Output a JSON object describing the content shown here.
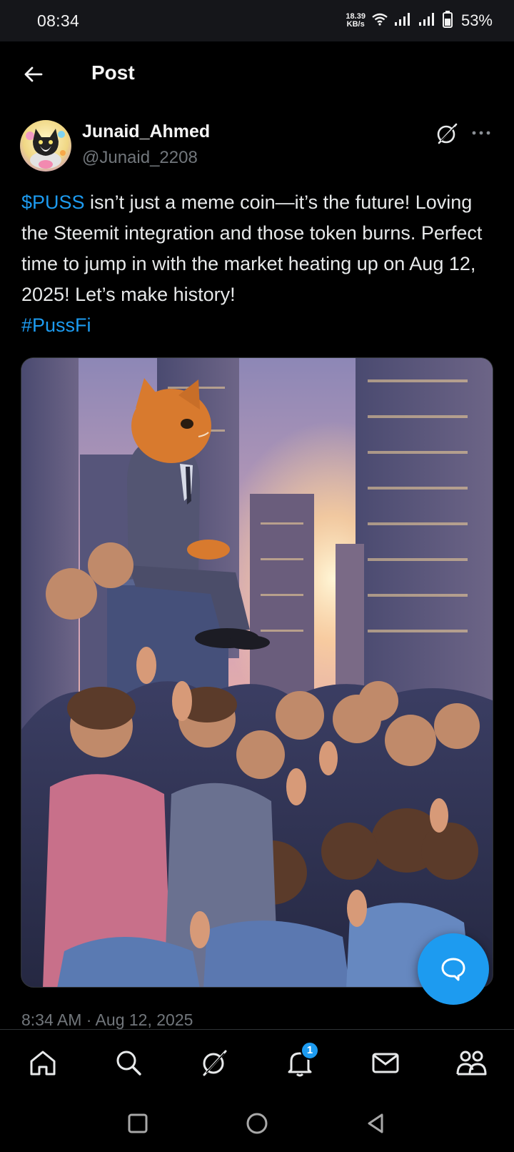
{
  "status": {
    "time": "08:34",
    "net_speed_value": "18.39",
    "net_speed_unit": "KB/s",
    "battery": "53%"
  },
  "header": {
    "title": "Post"
  },
  "author": {
    "name": "Junaid_Ahmed",
    "handle": "@Junaid_2208",
    "avatar_icon": "cat-avatar"
  },
  "post": {
    "cashtag": "$PUSS",
    "text": " isn’t just a meme coin—it’s the future! Loving the Steemit integration and those token burns. Perfect time to jump in with the market heating up on Aug 12, 2025! Let’s make history!",
    "hashtag": "#PussFi",
    "timestamp": "8:34 AM · Aug 12, 2025",
    "image_description_icon": "cat-in-suit-city-sunset-image"
  },
  "nav": {
    "items": [
      "home-icon",
      "search-icon",
      "grok-icon",
      "notifications-icon",
      "messages-icon",
      "communities-icon"
    ],
    "notification_badge": "1"
  },
  "colors": {
    "accent": "#1d9bf0",
    "background": "#000000",
    "secondary_text": "#71767b"
  }
}
